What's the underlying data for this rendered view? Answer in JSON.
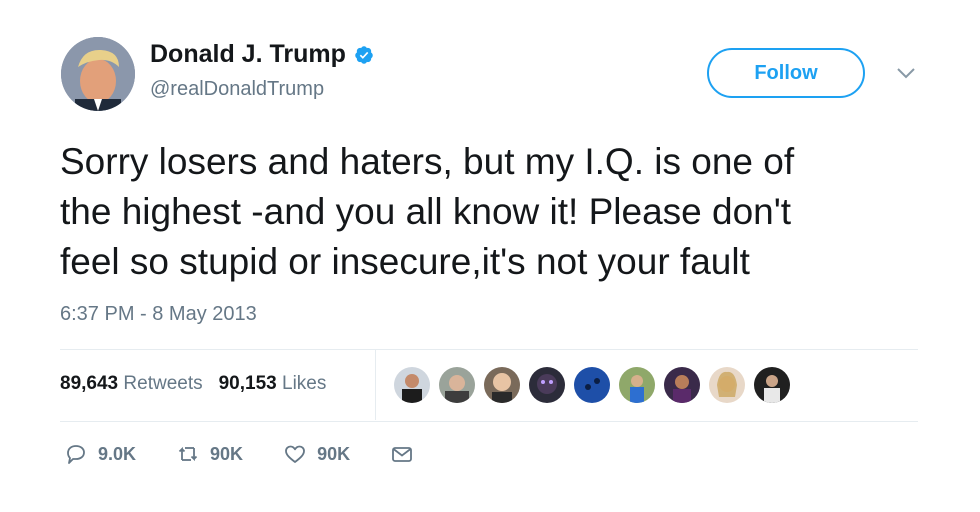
{
  "author": {
    "name": "Donald J. Trump",
    "handle": "@realDonaldTrump",
    "verified": true
  },
  "follow_button": {
    "label": "Follow"
  },
  "tweet": {
    "lines": [
      "Sorry losers and haters, but my I.Q. is one of",
      "the highest -and you all know it! Please don't",
      "feel so stupid or insecure,it's not your fault"
    ],
    "timestamp": "6:37 PM - 8 May 2013"
  },
  "stats": {
    "retweets_count": "89,643",
    "retweets_label": "Retweets",
    "likes_count": "90,153",
    "likes_label": "Likes"
  },
  "actions": {
    "reply_count": "9.0K",
    "retweet_count": "90K",
    "like_count": "90K"
  },
  "colors": {
    "accent": "#1da1f2",
    "muted": "#657786",
    "text": "#14171a"
  },
  "icons": [
    "verified-badge-icon",
    "caret-down-icon",
    "reply-icon",
    "retweet-icon",
    "heart-icon",
    "message-icon"
  ]
}
